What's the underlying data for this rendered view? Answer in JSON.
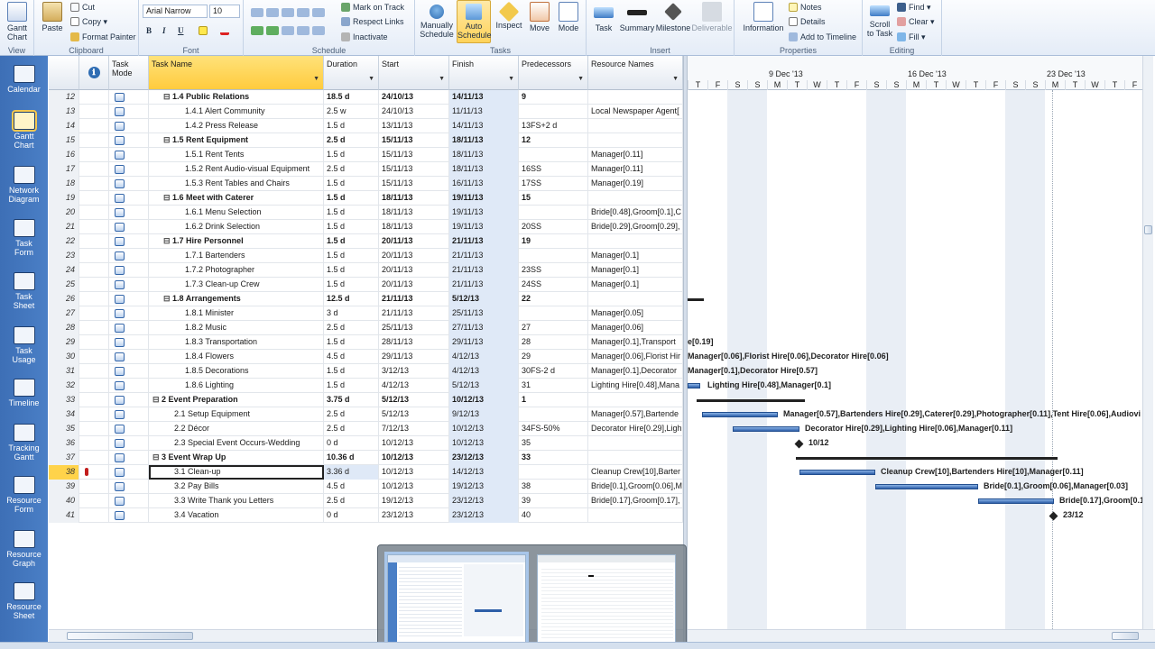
{
  "ribbon": {
    "view": {
      "label": "View",
      "gantt_chart": "Gantt\nChart"
    },
    "clipboard": {
      "label": "Clipboard",
      "paste": "Paste",
      "cut": "Cut",
      "copy": "Copy",
      "format_painter": "Format Painter"
    },
    "font": {
      "label": "Font",
      "font_name": "Arial Narrow",
      "font_size": "10",
      "bold": "B",
      "italic": "I",
      "underline": "U"
    },
    "schedule": {
      "label": "Schedule",
      "mark_on_track": "Mark on Track",
      "respect_links": "Respect Links",
      "inactivate": "Inactivate"
    },
    "tasks": {
      "label": "Tasks",
      "manually_schedule": "Manually\nSchedule",
      "auto_schedule": "Auto\nSchedule",
      "inspect": "Inspect",
      "move": "Move",
      "mode": "Mode"
    },
    "insert": {
      "label": "Insert",
      "task": "Task",
      "summary": "Summary",
      "milestone": "Milestone",
      "deliverable": "Deliverable"
    },
    "properties": {
      "label": "Properties",
      "information": "Information",
      "notes": "Notes",
      "details": "Details",
      "add_to_timeline": "Add to Timeline"
    },
    "editing": {
      "label": "Editing",
      "scroll_to_task": "Scroll\nto Task",
      "find": "Find",
      "clear": "Clear",
      "fill": "Fill"
    }
  },
  "viewbar": {
    "items": [
      {
        "label": "Calendar"
      },
      {
        "label": "Gantt\nChart"
      },
      {
        "label": "Network\nDiagram"
      },
      {
        "label": "Task\nForm"
      },
      {
        "label": "Task\nSheet"
      },
      {
        "label": "Task\nUsage"
      },
      {
        "label": "Timeline"
      },
      {
        "label": "Tracking\nGantt"
      },
      {
        "label": "Resource\nForm"
      },
      {
        "label": "Resource\nGraph"
      },
      {
        "label": "Resource\nSheet"
      }
    ]
  },
  "grid": {
    "columns": {
      "info": "ℹ",
      "task_mode": "Task\nMode",
      "task_name": "Task Name",
      "duration": "Duration",
      "start": "Start",
      "finish": "Finish",
      "predecessors": "Predecessors",
      "resource_names": "Resource Names"
    },
    "rows": [
      {
        "id": "12",
        "indent": 1,
        "summary": true,
        "name": "1.4 Public Relations",
        "duration": "18.5 d",
        "start": "24/10/13",
        "finish": "14/11/13",
        "pred": "9",
        "res": ""
      },
      {
        "id": "13",
        "indent": 2,
        "summary": false,
        "name": "1.4.1 Alert Community",
        "duration": "2.5 w",
        "start": "24/10/13",
        "finish": "11/11/13",
        "pred": "",
        "res": "Local Newspaper Agent["
      },
      {
        "id": "14",
        "indent": 2,
        "summary": false,
        "name": "1.4.2 Press Release",
        "duration": "1.5 d",
        "start": "13/11/13",
        "finish": "14/11/13",
        "pred": "13FS+2 d",
        "res": ""
      },
      {
        "id": "15",
        "indent": 1,
        "summary": true,
        "name": "1.5 Rent Equipment",
        "duration": "2.5 d",
        "start": "15/11/13",
        "finish": "18/11/13",
        "pred": "12",
        "res": ""
      },
      {
        "id": "16",
        "indent": 2,
        "summary": false,
        "name": "1.5.1 Rent Tents",
        "duration": "1.5 d",
        "start": "15/11/13",
        "finish": "18/11/13",
        "pred": "",
        "res": "Manager[0.11]"
      },
      {
        "id": "17",
        "indent": 2,
        "summary": false,
        "name": "1.5.2 Rent Audio-visual Equipment",
        "duration": "2.5 d",
        "start": "15/11/13",
        "finish": "18/11/13",
        "pred": "16SS",
        "res": "Manager[0.11]"
      },
      {
        "id": "18",
        "indent": 2,
        "summary": false,
        "name": "1.5.3 Rent Tables and Chairs",
        "duration": "1.5 d",
        "start": "15/11/13",
        "finish": "16/11/13",
        "pred": "17SS",
        "res": "Manager[0.19]"
      },
      {
        "id": "19",
        "indent": 1,
        "summary": true,
        "name": "1.6 Meet with Caterer",
        "duration": "1.5 d",
        "start": "18/11/13",
        "finish": "19/11/13",
        "pred": "15",
        "res": ""
      },
      {
        "id": "20",
        "indent": 2,
        "summary": false,
        "name": "1.6.1 Menu Selection",
        "duration": "1.5 d",
        "start": "18/11/13",
        "finish": "19/11/13",
        "pred": "",
        "res": "Bride[0.48],Groom[0.1],C"
      },
      {
        "id": "21",
        "indent": 2,
        "summary": false,
        "name": "1.6.2 Drink Selection",
        "duration": "1.5 d",
        "start": "18/11/13",
        "finish": "19/11/13",
        "pred": "20SS",
        "res": "Bride[0.29],Groom[0.29],"
      },
      {
        "id": "22",
        "indent": 1,
        "summary": true,
        "name": "1.7 Hire Personnel",
        "duration": "1.5 d",
        "start": "20/11/13",
        "finish": "21/11/13",
        "pred": "19",
        "res": ""
      },
      {
        "id": "23",
        "indent": 2,
        "summary": false,
        "name": "1.7.1 Bartenders",
        "duration": "1.5 d",
        "start": "20/11/13",
        "finish": "21/11/13",
        "pred": "",
        "res": "Manager[0.1]"
      },
      {
        "id": "24",
        "indent": 2,
        "summary": false,
        "name": "1.7.2 Photographer",
        "duration": "1.5 d",
        "start": "20/11/13",
        "finish": "21/11/13",
        "pred": "23SS",
        "res": "Manager[0.1]"
      },
      {
        "id": "25",
        "indent": 2,
        "summary": false,
        "name": "1.7.3 Clean-up Crew",
        "duration": "1.5 d",
        "start": "20/11/13",
        "finish": "21/11/13",
        "pred": "24SS",
        "res": "Manager[0.1]"
      },
      {
        "id": "26",
        "indent": 1,
        "summary": true,
        "name": "1.8 Arrangements",
        "duration": "12.5 d",
        "start": "21/11/13",
        "finish": "5/12/13",
        "pred": "22",
        "res": ""
      },
      {
        "id": "27",
        "indent": 2,
        "summary": false,
        "name": "1.8.1 Minister",
        "duration": "3 d",
        "start": "21/11/13",
        "finish": "25/11/13",
        "pred": "",
        "res": "Manager[0.05]"
      },
      {
        "id": "28",
        "indent": 2,
        "summary": false,
        "name": "1.8.2 Music",
        "duration": "2.5 d",
        "start": "25/11/13",
        "finish": "27/11/13",
        "pred": "27",
        "res": "Manager[0.06]"
      },
      {
        "id": "29",
        "indent": 2,
        "summary": false,
        "name": "1.8.3 Transportation",
        "duration": "1.5 d",
        "start": "28/11/13",
        "finish": "29/11/13",
        "pred": "28",
        "res": "Manager[0.1],Transport"
      },
      {
        "id": "30",
        "indent": 2,
        "summary": false,
        "name": "1.8.4 Flowers",
        "duration": "4.5 d",
        "start": "29/11/13",
        "finish": "4/12/13",
        "pred": "29",
        "res": "Manager[0.06],Florist Hir"
      },
      {
        "id": "31",
        "indent": 2,
        "summary": false,
        "name": "1.8.5 Decorations",
        "duration": "1.5 d",
        "start": "3/12/13",
        "finish": "4/12/13",
        "pred": "30FS-2 d",
        "res": "Manager[0.1],Decorator"
      },
      {
        "id": "32",
        "indent": 2,
        "summary": false,
        "name": "1.8.6 Lighting",
        "duration": "1.5 d",
        "start": "4/12/13",
        "finish": "5/12/13",
        "pred": "31",
        "res": "Lighting Hire[0.48],Mana"
      },
      {
        "id": "33",
        "indent": 0,
        "summary": true,
        "name": "2 Event Preparation",
        "duration": "3.75 d",
        "start": "5/12/13",
        "finish": "10/12/13",
        "pred": "1",
        "res": ""
      },
      {
        "id": "34",
        "indent": 1,
        "summary": false,
        "name": "2.1 Setup Equipment",
        "duration": "2.5 d",
        "start": "5/12/13",
        "finish": "9/12/13",
        "pred": "",
        "res": "Manager[0.57],Bartende"
      },
      {
        "id": "35",
        "indent": 1,
        "summary": false,
        "name": "2.2 Décor",
        "duration": "2.5 d",
        "start": "7/12/13",
        "finish": "10/12/13",
        "pred": "34FS-50%",
        "res": "Decorator Hire[0.29],Ligh"
      },
      {
        "id": "36",
        "indent": 1,
        "summary": false,
        "name": "2.3 Special Event Occurs-Wedding",
        "duration": "0 d",
        "start": "10/12/13",
        "finish": "10/12/13",
        "pred": "35",
        "res": ""
      },
      {
        "id": "37",
        "indent": 0,
        "summary": true,
        "name": "3 Event Wrap Up",
        "duration": "10.36 d",
        "start": "10/12/13",
        "finish": "23/12/13",
        "pred": "33",
        "res": ""
      },
      {
        "id": "38",
        "indent": 1,
        "summary": false,
        "name": "3.1 Clean-up",
        "duration": "3.36 d",
        "start": "10/12/13",
        "finish": "14/12/13",
        "pred": "",
        "res": "Cleanup Crew[10],Barter"
      },
      {
        "id": "39",
        "indent": 1,
        "summary": false,
        "name": "3.2 Pay Bills",
        "duration": "4.5 d",
        "start": "10/12/13",
        "finish": "19/12/13",
        "pred": "38",
        "res": "Bride[0.1],Groom[0.06],M"
      },
      {
        "id": "40",
        "indent": 1,
        "summary": false,
        "name": "3.3 Write Thank you Letters",
        "duration": "2.5 d",
        "start": "19/12/13",
        "finish": "23/12/13",
        "pred": "39",
        "res": "Bride[0.17],Groom[0.17],"
      },
      {
        "id": "41",
        "indent": 1,
        "summary": false,
        "name": "3.4 Vacation",
        "duration": "0 d",
        "start": "23/12/13",
        "finish": "23/12/13",
        "pred": "40",
        "res": ""
      }
    ]
  },
  "gantt": {
    "weeks": [
      "9 Dec '13",
      "16 Dec '13",
      "23 Dec '13"
    ],
    "days": [
      "T",
      "F",
      "S",
      "S",
      "M",
      "T",
      "W",
      "T",
      "F",
      "S",
      "S",
      "M",
      "T",
      "W",
      "T",
      "F",
      "S",
      "S",
      "M",
      "T",
      "W",
      "T",
      "F"
    ],
    "labels": {
      "l29": "e[0.19]",
      "l30": "Manager[0.06],Florist Hire[0.06],Decorator Hire[0.06]",
      "l31": "Manager[0.1],Decorator Hire[0.57]",
      "l32": "Lighting Hire[0.48],Manager[0.1]",
      "l34": "Manager[0.57],Bartenders Hire[0.29],Caterer[0.29],Photographer[0.11],Tent Hire[0.06],Audiovi",
      "l35": "Decorator Hire[0.29],Lighting Hire[0.06],Manager[0.11]",
      "l36": "10/12",
      "l38": "Cleanup Crew[10],Bartenders Hire[10],Manager[0.11]",
      "l39": "Bride[0.1],Groom[0.06],Manager[0.03]",
      "l40": "Bride[0.17],Groom[0.1",
      "l41": "23/12"
    }
  },
  "colors": {
    "accent": "#ffcb3d",
    "viewbar": "#3d6fb6",
    "bar": "#2d5fa8"
  }
}
